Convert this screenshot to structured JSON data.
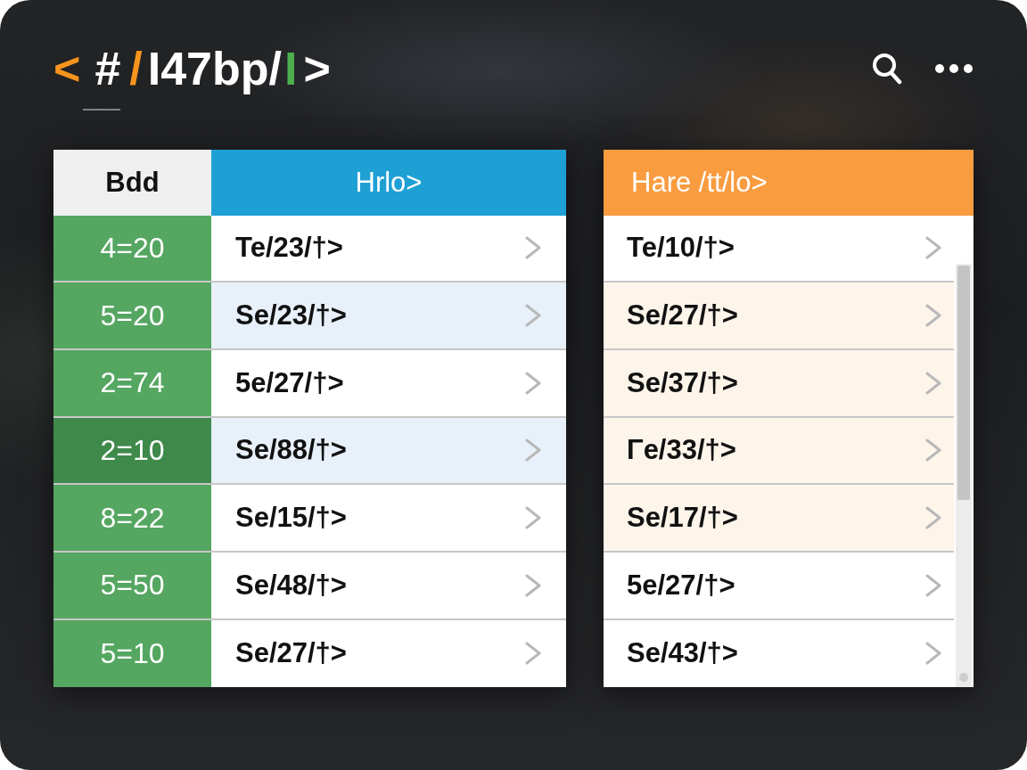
{
  "header": {
    "logo": [
      {
        "text": "<",
        "color": "#f7941d"
      },
      {
        "text": "#",
        "color": "#ffffff"
      },
      {
        "text": "/",
        "color": "#f7941d"
      },
      {
        "text": "I47bp/",
        "color": "#ffffff"
      },
      {
        "text": "I",
        "color": "#4caf50"
      },
      {
        "text": ">",
        "color": "#ffffff"
      }
    ]
  },
  "left_table": {
    "columns": [
      "Bdd",
      "Hrlo>"
    ],
    "rows": [
      {
        "code": "4=20",
        "label": "Te/23/†>",
        "selected": false,
        "highlighted": false
      },
      {
        "code": "5=20",
        "label": "Se/23/†>",
        "selected": false,
        "highlighted": true
      },
      {
        "code": "2=74",
        "label": "5e/27/†>",
        "selected": false,
        "highlighted": false
      },
      {
        "code": "2=10",
        "label": "Se/88/†>",
        "selected": true,
        "highlighted": true
      },
      {
        "code": "8=22",
        "label": "Se/15/†>",
        "selected": false,
        "highlighted": false
      },
      {
        "code": "5=50",
        "label": "Se/48/†>",
        "selected": false,
        "highlighted": false
      },
      {
        "code": "5=10",
        "label": "Se/27/†>",
        "selected": false,
        "highlighted": false
      }
    ]
  },
  "right_list": {
    "title": "Hare /tt/lo>",
    "rows": [
      {
        "label": "Te/10/†>",
        "highlighted": false
      },
      {
        "label": "Se/27/†>",
        "highlighted": true
      },
      {
        "label": "Se/37/†>",
        "highlighted": true
      },
      {
        "label": "Γe/33/†>",
        "highlighted": true
      },
      {
        "label": "Se/17/†>",
        "highlighted": true
      },
      {
        "label": "5e/27/†>",
        "highlighted": false
      },
      {
        "label": "Se/43/†>",
        "highlighted": false
      }
    ]
  }
}
